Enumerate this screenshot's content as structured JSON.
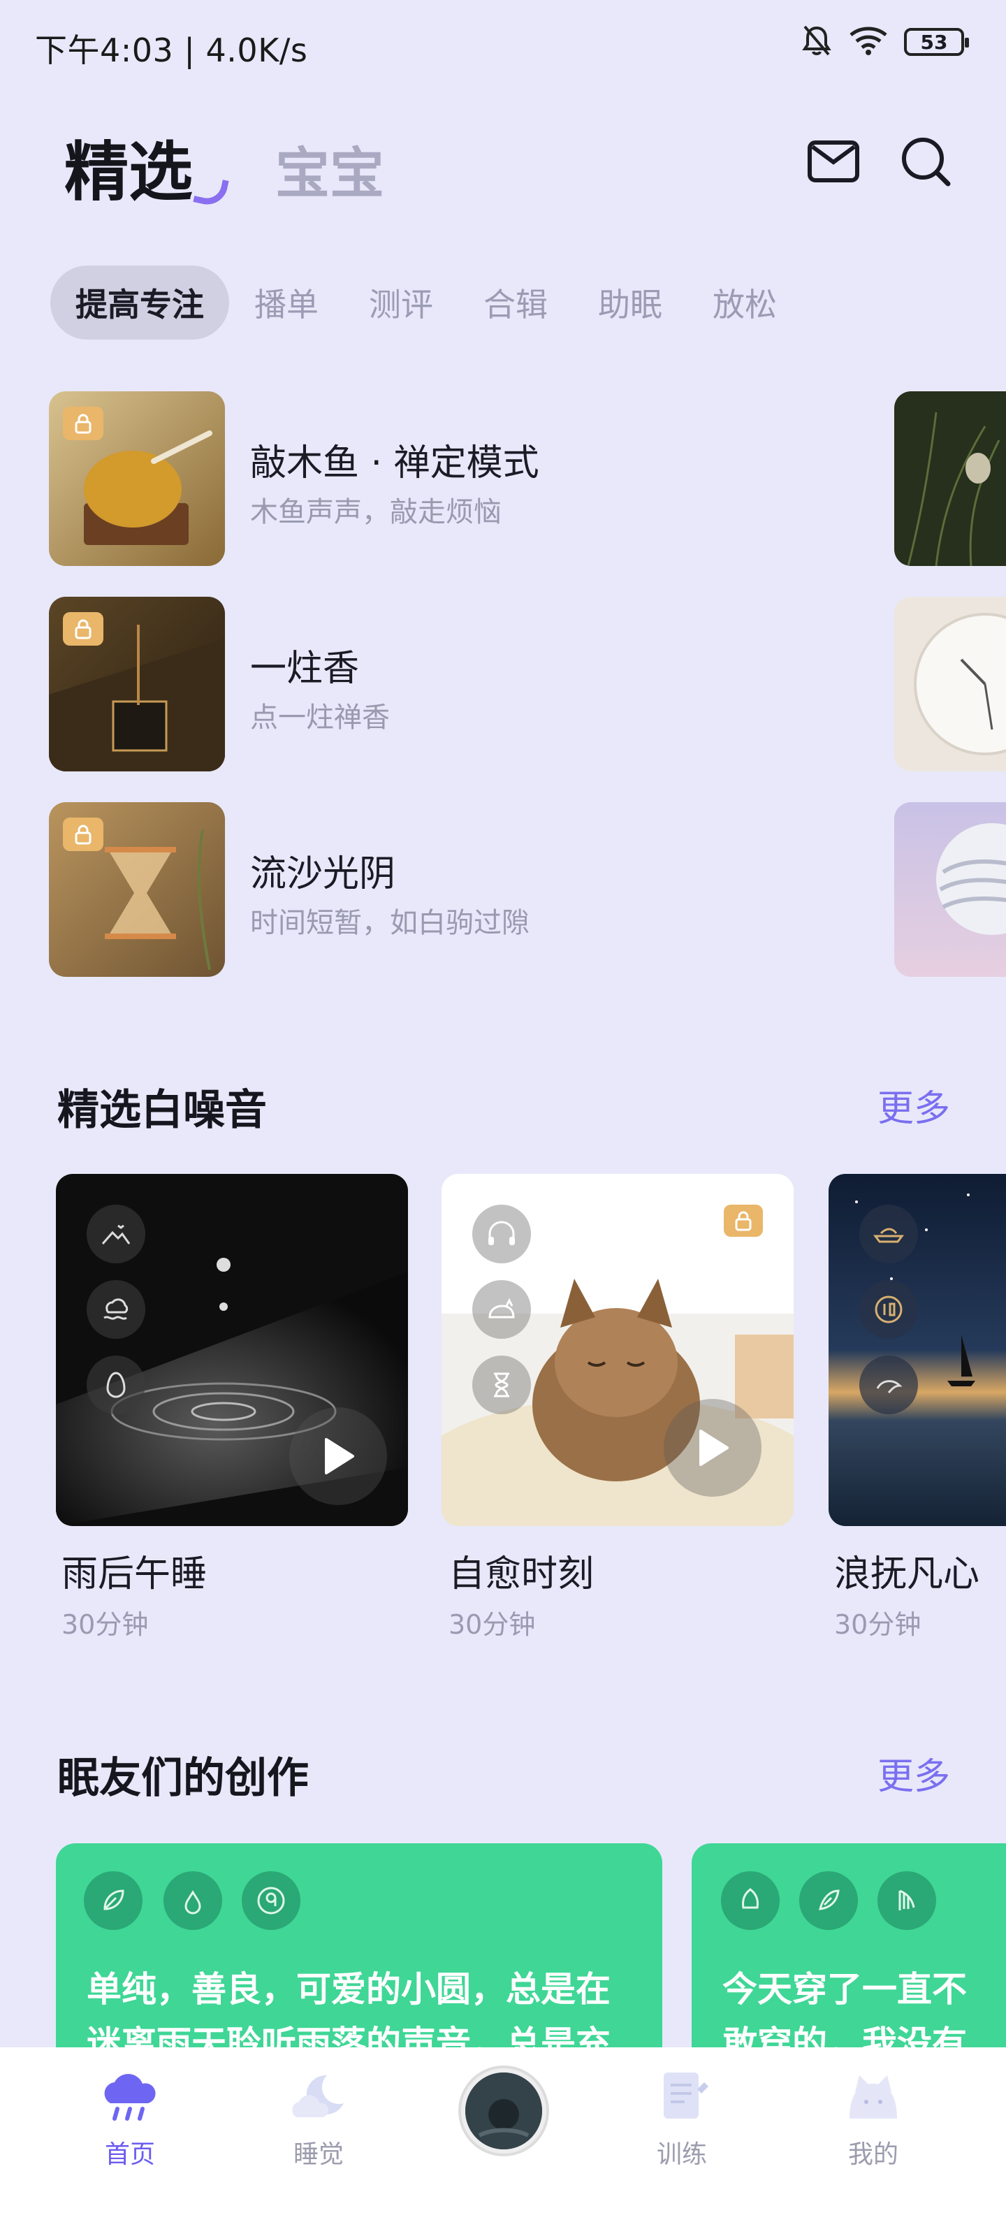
{
  "status_bar": {
    "time_speed": "下午4:03 | 4.0K/s",
    "battery": "53",
    "icons": [
      "bell-muted-icon",
      "wifi-icon",
      "battery-icon"
    ]
  },
  "header": {
    "tab_main": "精选",
    "tab_secondary": "宝宝",
    "icons": [
      "mail-icon",
      "search-icon"
    ]
  },
  "chips": [
    "提高专注",
    "播单",
    "测评",
    "合辑",
    "助眠",
    "放松"
  ],
  "featured": [
    {
      "title": "敲木鱼 · 禅定模式",
      "subtitle": "木鱼声声，敲走烦恼"
    },
    {
      "title": "一炷香",
      "subtitle": "点一炷禅香"
    },
    {
      "title": "流沙光阴",
      "subtitle": "时间短暂，如白驹过隙"
    }
  ],
  "white_noise": {
    "title": "精选白噪音",
    "more": "更多",
    "cards": [
      {
        "title": "雨后午睡",
        "duration": "30分钟"
      },
      {
        "title": "自愈时刻",
        "duration": "30分钟"
      },
      {
        "title": "浪抚凡心",
        "duration": "30分钟"
      }
    ]
  },
  "creations": {
    "title": "眠友们的创作",
    "more": "更多",
    "cards": [
      {
        "text": "单纯，善良，可爱的小圆，总是在迷离雨天聆听雨落的声音，总是充满勇气，无拘无束的"
      },
      {
        "text": "今天穿了一直不敢穿的，我没有必要我因为别人的眼光，而留意退了"
      }
    ]
  },
  "bottom_nav": [
    {
      "label": "首页",
      "icon": "cloud-rain-icon",
      "active": true
    },
    {
      "label": "睡觉",
      "icon": "moon-cloud-icon",
      "active": false
    },
    {
      "label": "",
      "icon": "now-playing-icon",
      "active": false
    },
    {
      "label": "训练",
      "icon": "notebook-icon",
      "active": false
    },
    {
      "label": "我的",
      "icon": "cat-icon",
      "active": false
    }
  ],
  "colors": {
    "background": "#e8e8fa",
    "accent": "#7a6ff0",
    "green_card": "#3fd696",
    "lock_badge": "#e9b66a"
  }
}
